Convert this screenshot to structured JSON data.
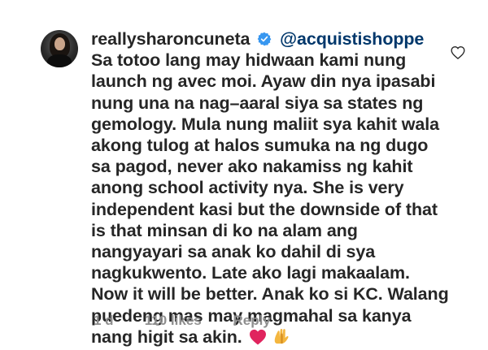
{
  "comment": {
    "username": "reallysharoncuneta",
    "mention": "@acquistishoppe",
    "text": "Sa totoo lang may hidwaan kami nung launch ng avec moi. Ayaw din nya ipasabi nung una na nag–aaral siya sa states ng gemology. Mula nung maliit sya kahit wala akong tulog at halos sumuka na ng dugo sa pagod, never ako nakamiss ng kahit anong school activity nya. She is very independent kasi but the downside of that is that minsan di ko na alam ang nangyayari sa anak ko dahil di sya nagkukwento. Late ako lagi makaalam. Now it will be better. Anak ko si KC. Walang puedeng mas may magmahal sa kanya nang higit sa akin.",
    "emojis": [
      "red-heart-icon",
      "pleading-hands-icon"
    ],
    "time": "1 d",
    "likes": "110 likes",
    "reply_label": "Reply"
  },
  "colors": {
    "text": "#262626",
    "mention": "#00376b",
    "meta": "#8e8e8e",
    "verified": "#3897f0",
    "heart_emoji": "#e0245e"
  }
}
